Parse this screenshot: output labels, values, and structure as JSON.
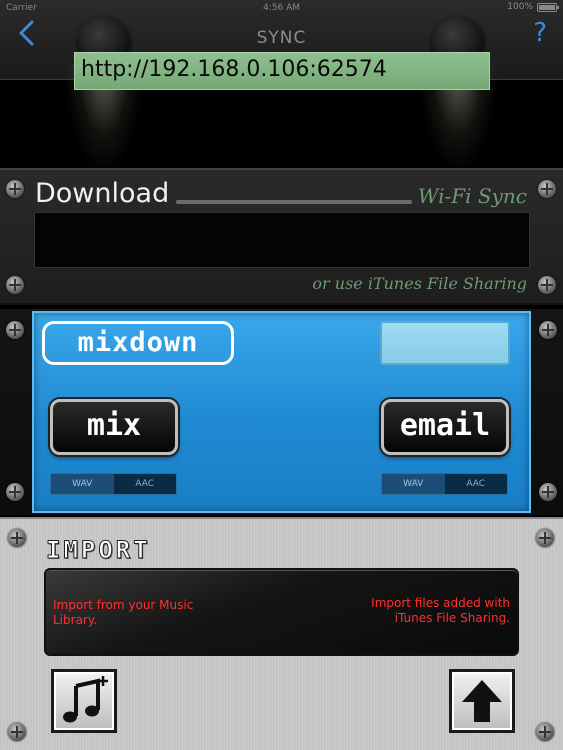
{
  "status_bar": {
    "carrier": "Carrier",
    "time": "4:56 AM",
    "battery": "100%"
  },
  "nav": {
    "title": "SYNC",
    "back_icon": "chevron-left-icon",
    "help_label": "?"
  },
  "download": {
    "title": "Download",
    "wifi_label": "Wi-Fi Sync",
    "url": "http://192.168.0.106:62574",
    "itunes_hint": "or use iTunes File Sharing"
  },
  "mixdown": {
    "logo": "mixdown",
    "mix_button": "mix",
    "email_button": "email",
    "left_format": {
      "options": [
        "WAV",
        "AAC"
      ],
      "selected": "WAV"
    },
    "right_format": {
      "options": [
        "WAV",
        "AAC"
      ],
      "selected": "WAV"
    }
  },
  "import": {
    "title": "IMPORT",
    "music_library_text": "Import from your Music Library.",
    "itunes_text": "Import files added with iTunes File Sharing.",
    "music_button_icon": "music-note-plus-icon",
    "upload_button_icon": "arrow-up-icon"
  },
  "colors": {
    "help_blue": "#3d8ad8",
    "wifi_green": "#6f9a72",
    "url_green": "#8fbf8f",
    "mixdown_blue": "#2a97de",
    "import_red": "#ff3030"
  }
}
